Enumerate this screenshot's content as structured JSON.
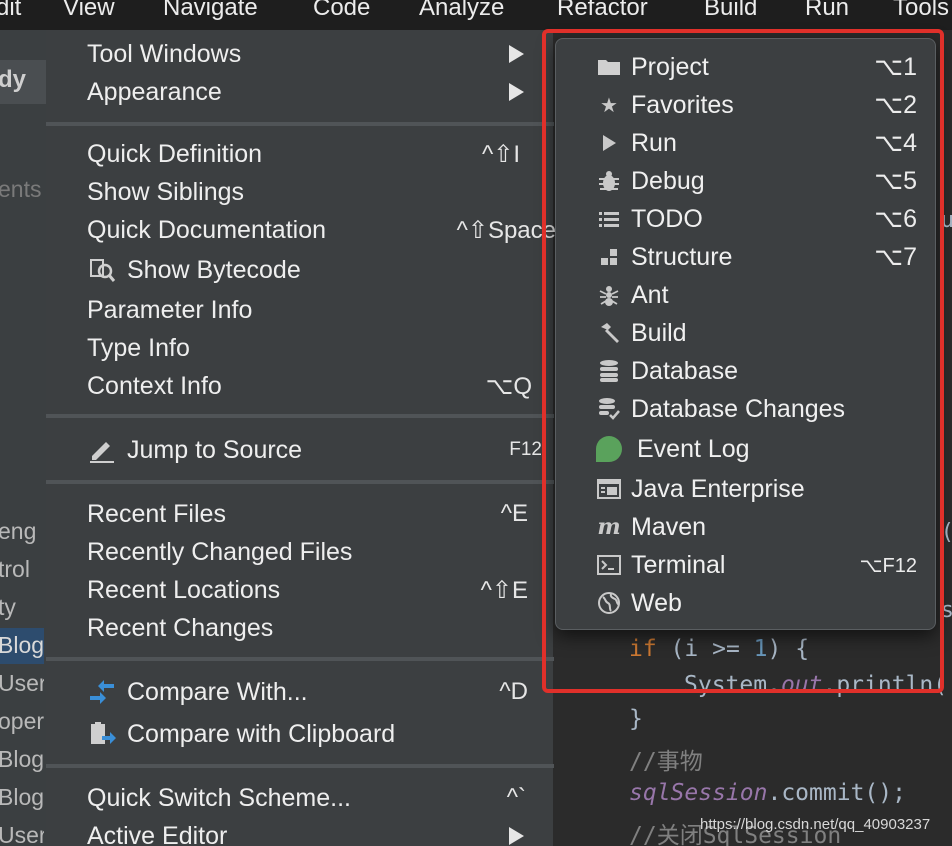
{
  "menubar": {
    "items": [
      "dit",
      "View",
      "Navigate",
      "Code",
      "Analyze",
      "Refactor",
      "Build",
      "Run",
      "Tools"
    ]
  },
  "background_left": {
    "breadcrumb": "dy",
    "fragments": [
      "ents",
      "eng",
      "trol",
      "ty",
      "Blog",
      "User",
      "oper",
      "Blog",
      "Blog",
      "User"
    ]
  },
  "main_menu": {
    "tool_windows": "Tool Windows",
    "appearance": "Appearance",
    "quick_definition": {
      "label": "Quick Definition",
      "shortcut": "^⇧I"
    },
    "show_siblings": "Show Siblings",
    "quick_documentation": {
      "label": "Quick Documentation",
      "shortcut": "^⇧Space"
    },
    "show_bytecode": "Show Bytecode",
    "parameter_info": "Parameter Info",
    "type_info": "Type Info",
    "context_info": {
      "label": "Context Info",
      "shortcut": "⌥Q"
    },
    "jump_to_source": {
      "label": "Jump to Source",
      "shortcut": "F12"
    },
    "recent_files": {
      "label": "Recent Files",
      "shortcut": "^E"
    },
    "recently_changed_files": "Recently Changed Files",
    "recent_locations": {
      "label": "Recent Locations",
      "shortcut": "^⇧E"
    },
    "recent_changes": "Recent Changes",
    "compare_with": {
      "label": "Compare With...",
      "shortcut": "^D"
    },
    "compare_with_clipboard": "Compare with Clipboard",
    "quick_switch_scheme": {
      "label": "Quick Switch Scheme...",
      "shortcut": "^`"
    },
    "active_editor": "Active Editor"
  },
  "tool_windows_submenu": [
    {
      "label": "Project",
      "shortcut": "⌥1",
      "icon": "folder-icon"
    },
    {
      "label": "Favorites",
      "shortcut": "⌥2",
      "icon": "star-icon"
    },
    {
      "label": "Run",
      "shortcut": "⌥4",
      "icon": "play-icon"
    },
    {
      "label": "Debug",
      "shortcut": "⌥5",
      "icon": "bug-icon"
    },
    {
      "label": "TODO",
      "shortcut": "⌥6",
      "icon": "list-icon"
    },
    {
      "label": "Structure",
      "shortcut": "⌥7",
      "icon": "structure-icon"
    },
    {
      "label": "Ant",
      "shortcut": "",
      "icon": "ant-icon"
    },
    {
      "label": "Build",
      "shortcut": "",
      "icon": "hammer-icon"
    },
    {
      "label": "Database",
      "shortcut": "",
      "icon": "database-icon"
    },
    {
      "label": "Database Changes",
      "shortcut": "",
      "icon": "database-changes-icon"
    },
    {
      "label": "Event Log",
      "shortcut": "",
      "icon": "event-log-icon"
    },
    {
      "label": "Java Enterprise",
      "shortcut": "",
      "icon": "java-enterprise-icon"
    },
    {
      "label": "Maven",
      "shortcut": "",
      "icon": "maven-icon"
    },
    {
      "label": "Terminal",
      "shortcut": "⌥F12",
      "icon": "terminal-icon"
    },
    {
      "label": "Web",
      "shortcut": "",
      "icon": "globe-icon"
    }
  ],
  "editor": {
    "line_if_kw": "if",
    "line_if_rest": " (i >= ",
    "line_if_num": "1",
    "line_if_end": ") {",
    "line_sys": "System.",
    "line_sys_field": "out",
    "line_sys_rest": ".println(",
    "line_close": "}",
    "comment1": "//事物",
    "session_var": "sqlSession",
    "session_rest": ".commit();",
    "comment2": "//关闭SqlSession",
    "edge_chars": [
      "u",
      "(",
      "s",
      "("
    ]
  },
  "watermark": "https://blog.csdn.net/qq_40903237",
  "colors": {
    "highlight": "#e0302a",
    "accent_green": "#5aa25c",
    "compare_blue": "#3a8fd8"
  }
}
